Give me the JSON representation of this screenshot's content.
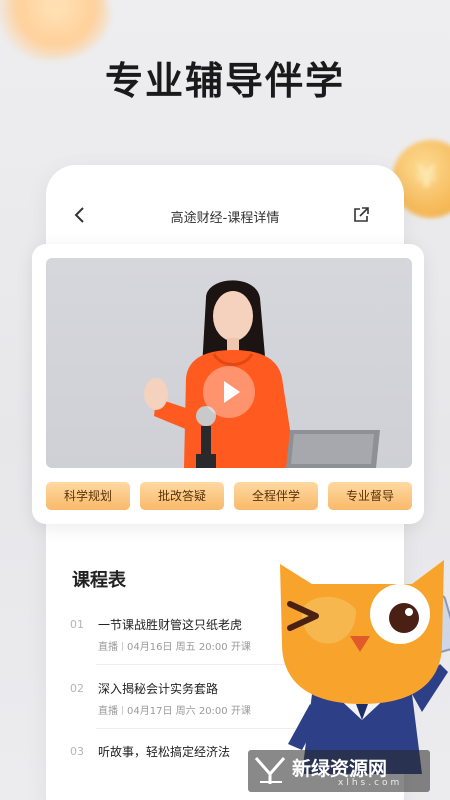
{
  "headline": "专业辅导伴学",
  "nav": {
    "title": "高途财经-课程详情"
  },
  "video": {
    "play_label": "play"
  },
  "tags": [
    "科学规划",
    "批改答疑",
    "全程伴学",
    "专业督导"
  ],
  "schedule": {
    "title": "课程表",
    "courses": [
      {
        "num": "01",
        "title": "一节课战胜财管这只纸老虎",
        "type": "直播",
        "date": "04月16日",
        "weekday": "周五",
        "time": "20:00",
        "status": "开课"
      },
      {
        "num": "02",
        "title": "深入揭秘会计实务套路",
        "type": "直播",
        "date": "04月17日",
        "weekday": "周六",
        "time": "20:00",
        "status": "开课"
      },
      {
        "num": "03",
        "title": "听故事，轻松搞定经济法",
        "type": "",
        "date": "",
        "weekday": "",
        "time": "",
        "status": ""
      }
    ]
  },
  "watermark": {
    "text": "新绿资源网",
    "sub": "xlhs.com"
  },
  "colors": {
    "accent": "#f9b96a",
    "tag_text": "#5a3208",
    "hoodie": "#ff5a1f",
    "mascot": "#f8a42c"
  }
}
